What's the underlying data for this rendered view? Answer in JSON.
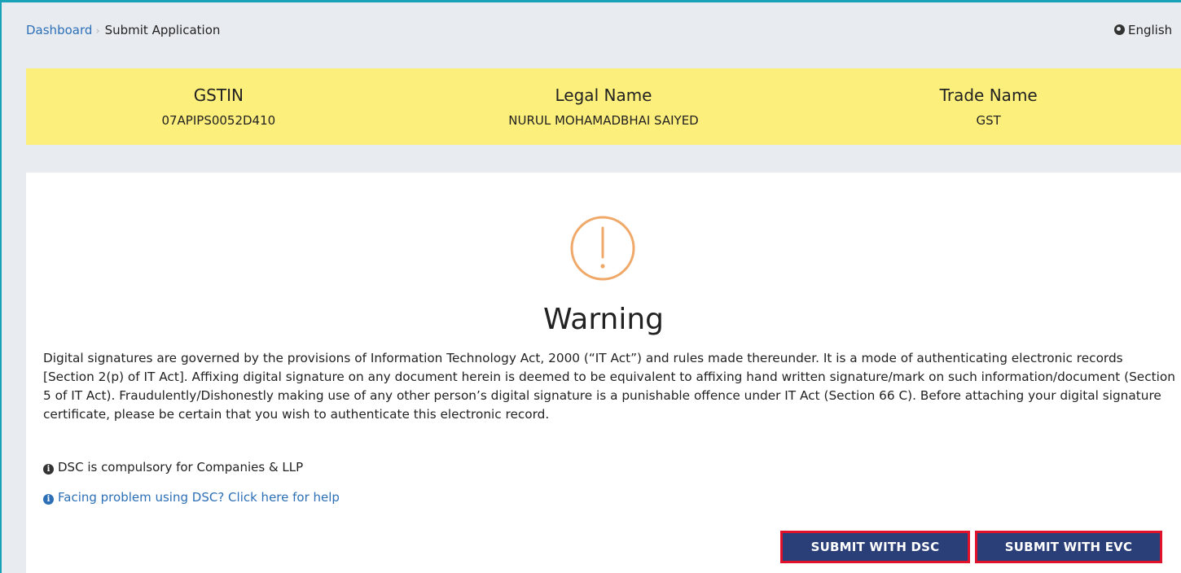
{
  "breadcrumb": {
    "home": "Dashboard",
    "separator": "›",
    "current": "Submit Application"
  },
  "language": {
    "icon": "globe-icon",
    "label": "English"
  },
  "taxpayer": {
    "gstin_label": "GSTIN",
    "gstin_value": "07APIPS0052D410",
    "legal_name_label": "Legal Name",
    "legal_name_value": "NURUL MOHAMADBHAI SAIYED",
    "trade_name_label": "Trade Name",
    "trade_name_value": "GST"
  },
  "warning": {
    "icon": "exclamation-circle-icon",
    "title": "Warning",
    "text": "Digital signatures are governed by the provisions of Information Technology Act, 2000 (“IT Act”) and rules made thereunder. It is a mode of authenticating electronic records [Section 2(p) of IT Act]. Affixing digital signature on any document herein is deemed to be equivalent to affixing hand written signature/mark on such information/document (Section 5 of IT Act). Fraudulently/Dishonestly making use of any other person’s digital signature is a punishable offence under IT Act (Section 66 C). Before attaching your digital signature certificate, please be certain that you wish to authenticate this electronic record."
  },
  "notes": {
    "dsc_compulsory": "DSC is compulsory for Companies & LLP",
    "help_link": "Facing problem using DSC? Click here for help",
    "info_glyph": "i"
  },
  "actions": {
    "submit_dsc": "SUBMIT WITH DSC",
    "submit_evc": "SUBMIT WITH EVC"
  },
  "colors": {
    "band": "#fdef7b",
    "button": "#2a3e78",
    "highlight": "#e0112b",
    "link": "#2c6fb7",
    "warning_icon": "#f0a868"
  }
}
